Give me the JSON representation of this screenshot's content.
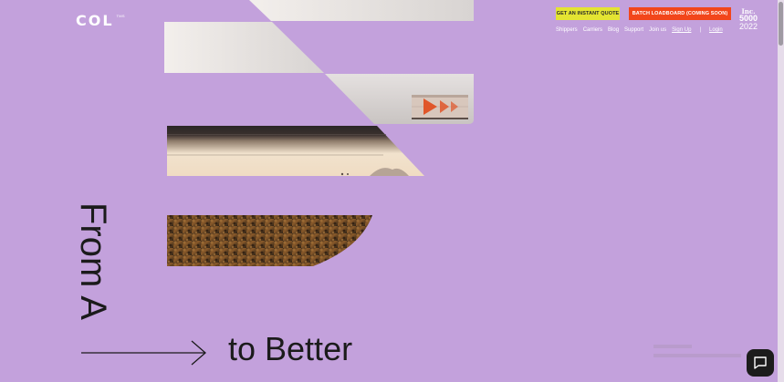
{
  "brand": {
    "name": "COL",
    "sup": "TMS"
  },
  "header": {
    "quote_button": "GET AN INSTANT QUOTE",
    "batch_button": "BATCH LOADBOARD (COMING SOON)",
    "nav": {
      "shippers": "Shippers",
      "carriers": "Carriers",
      "blog": "Blog",
      "support": "Support",
      "join": "Join us",
      "signup": "Sign Up",
      "separator": "|",
      "login": "Login"
    },
    "badge": {
      "line1": "Inc.",
      "line2": "5000",
      "line3": "2022"
    }
  },
  "hero": {
    "vertical_text": "From A",
    "horizontal_text": "to Better"
  },
  "chat": {
    "icon": "chat-bubble-icon"
  },
  "colors": {
    "background": "#c3a1dc",
    "quote_button": "#e4e432",
    "batch_button": "#f2461b",
    "text_dark": "#1b1b1b",
    "text_light": "#ffffff"
  }
}
